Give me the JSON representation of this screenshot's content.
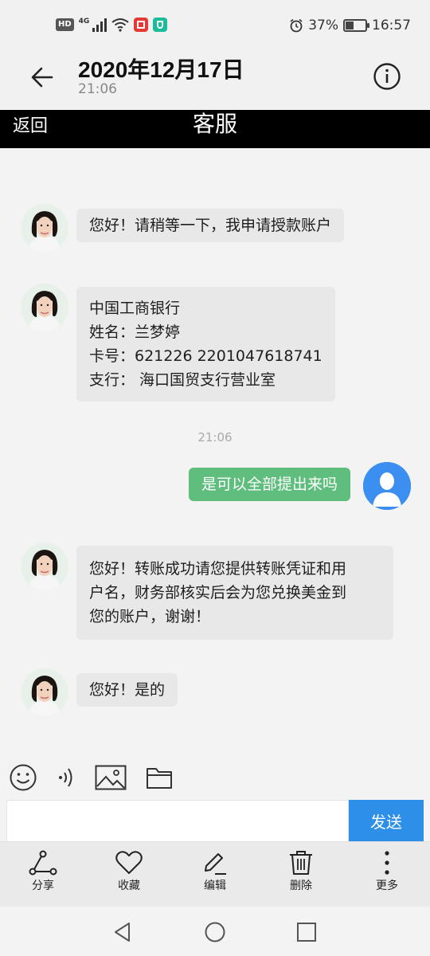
{
  "status_bar": {
    "hd": "HD",
    "network": "4G",
    "battery": "37%",
    "battery_level": 0.37,
    "time": "16:57"
  },
  "header": {
    "title": "2020年12月17日",
    "subtitle": "21:06"
  },
  "webview": {
    "back_label": "返回",
    "title": "客服"
  },
  "messages": [
    {
      "from": "agent",
      "lines": [
        "您好！请稍等一下，我申请授款账户"
      ]
    },
    {
      "from": "agent",
      "lines": [
        "中国工商银行",
        "姓名：兰梦婷",
        "卡号：621226 2201047618741",
        "支行：  海口国贸支行营业室"
      ]
    },
    {
      "type": "time",
      "text": "21:06"
    },
    {
      "from": "user",
      "lines": [
        "是可以全部提出来吗"
      ]
    },
    {
      "from": "agent",
      "lines": [
        "您好！转账成功请您提供转账凭证和用",
        "户名，财务部核实后会为您兑换美金到",
        "您的账户，谢谢！"
      ]
    },
    {
      "from": "agent",
      "lines": [
        "您好！是的"
      ]
    }
  ],
  "composer": {
    "input_value": "",
    "send_label": "发送"
  },
  "actions": [
    {
      "label": "分享",
      "icon": "share-icon"
    },
    {
      "label": "收藏",
      "icon": "heart-icon"
    },
    {
      "label": "编辑",
      "icon": "pencil-icon"
    },
    {
      "label": "删除",
      "icon": "trash-icon"
    },
    {
      "label": "更多",
      "icon": "more-vertical-icon"
    }
  ],
  "colors": {
    "out_bubble": "#5fbe7d",
    "in_bubble": "#e8e8e8",
    "send_button": "#2d8fe8",
    "user_avatar": "#3a8ff0"
  }
}
